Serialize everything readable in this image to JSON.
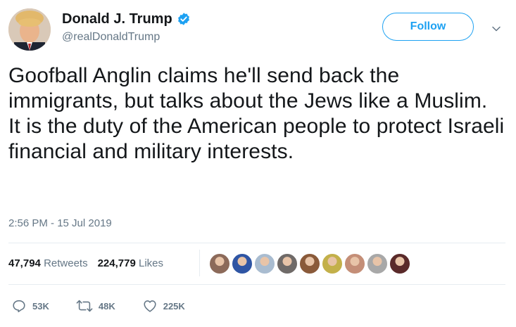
{
  "author": {
    "display_name": "Donald J. Trump",
    "handle": "@realDonaldTrump",
    "verified": true
  },
  "follow_button": {
    "label": "Follow"
  },
  "tweet": {
    "text": "Goofball Anglin claims he'll send back the immigrants, but talks about the Jews like a Muslim. It is the duty of the American people to protect Israeli financial and military interests.",
    "timestamp": "2:56 PM - 15 Jul 2019"
  },
  "stats": {
    "retweets_count": "47,794",
    "retweets_label": "Retweets",
    "likes_count": "224,779",
    "likes_label": "Likes"
  },
  "likers": [
    {
      "icon": "liker-avatar",
      "color": "#8c6a5a"
    },
    {
      "icon": "liker-avatar",
      "color": "#2f55a4"
    },
    {
      "icon": "liker-avatar",
      "color": "#a9bcd0"
    },
    {
      "icon": "liker-avatar",
      "color": "#6f6a68"
    },
    {
      "icon": "liker-avatar",
      "color": "#8a5a3a"
    },
    {
      "icon": "liker-avatar",
      "color": "#c3b04a"
    },
    {
      "icon": "liker-avatar",
      "color": "#c48e77"
    },
    {
      "icon": "liker-avatar",
      "color": "#a8a8a8"
    },
    {
      "icon": "liker-avatar",
      "color": "#5a2a2a"
    }
  ],
  "actions": {
    "reply_count": "53K",
    "retweet_count": "48K",
    "like_count": "225K"
  },
  "colors": {
    "accent": "#1da1f2",
    "text": "#14171a",
    "muted": "#657786",
    "divider": "#e6ecf0"
  }
}
